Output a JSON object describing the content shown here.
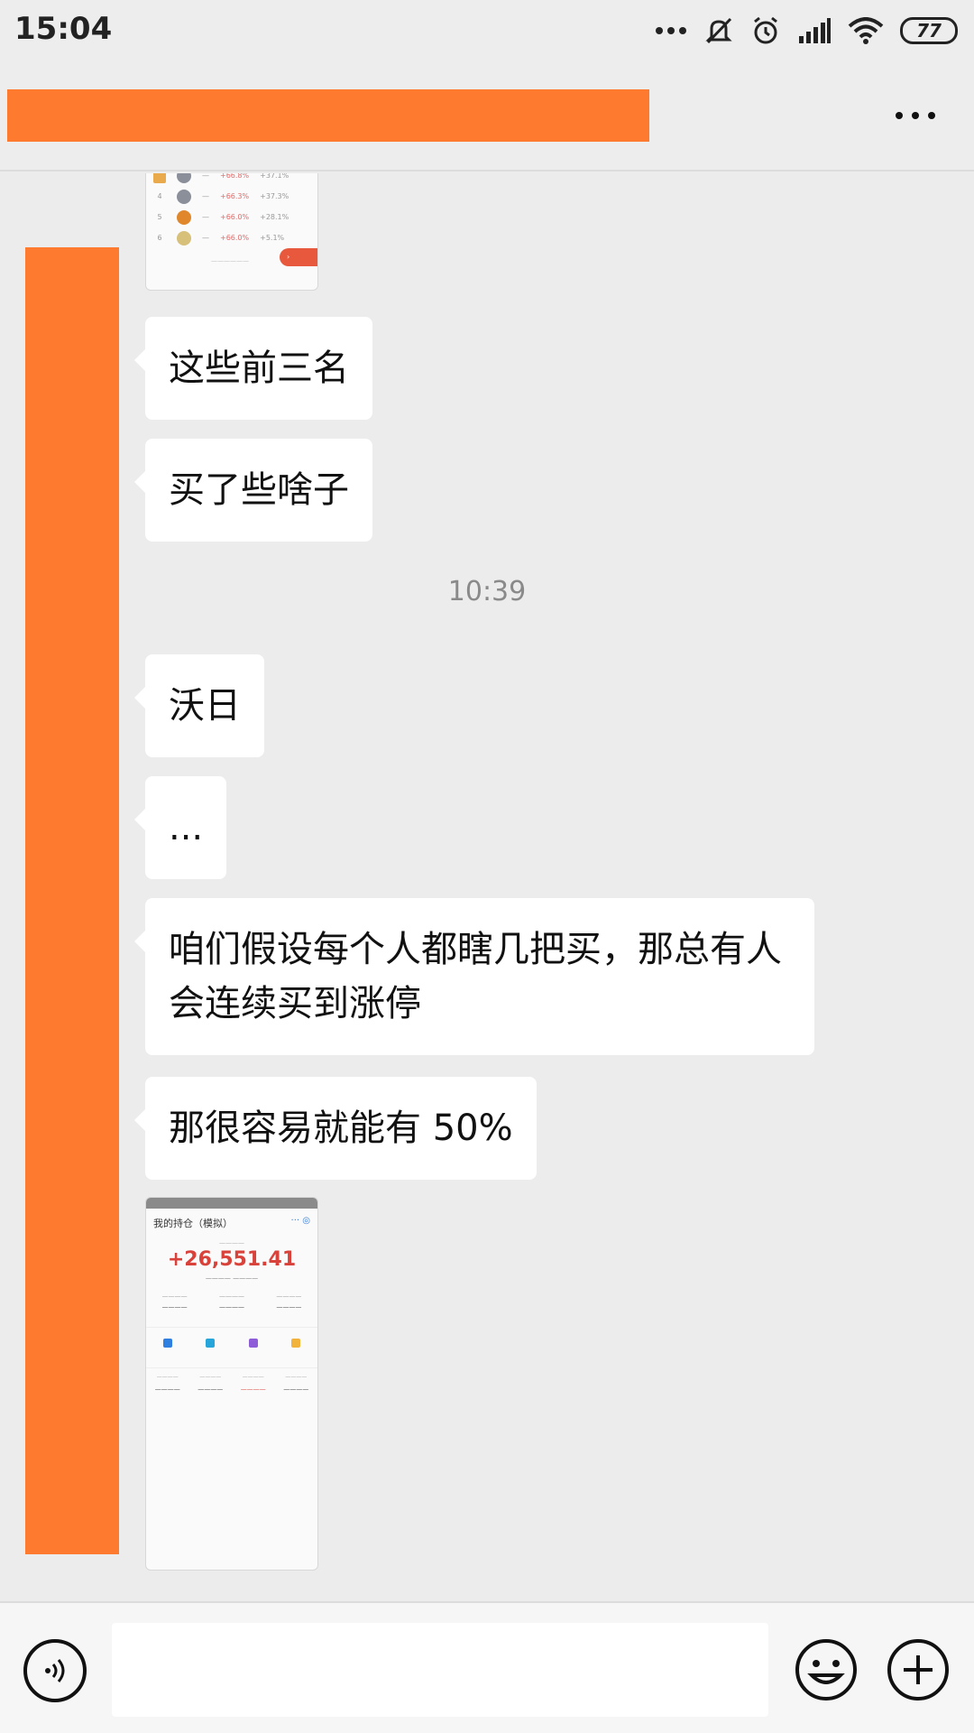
{
  "status_bar": {
    "time": "15:04",
    "battery": "77"
  },
  "chat": {
    "messages": [
      {
        "type": "image",
        "description_id": "leaderboard"
      },
      {
        "type": "text",
        "text": "这些前三名"
      },
      {
        "type": "text",
        "text": "买了些啥子"
      },
      {
        "type": "timestamp",
        "text": "10:39"
      },
      {
        "type": "text",
        "text": "沃日"
      },
      {
        "type": "text",
        "text": "..."
      },
      {
        "type": "text",
        "text": "咱们假设每个人都瞎几把买，那总有人会连续买到涨停"
      },
      {
        "type": "text",
        "text": "那很容易就能有 50%"
      },
      {
        "type": "image",
        "description_id": "portfolio"
      }
    ],
    "image2": {
      "title": "我的持仓（模拟）",
      "amount": "+26,551.41"
    }
  },
  "colors": {
    "redaction": "#fd7a2e",
    "background": "#ececec",
    "bubble": "#ffffff"
  },
  "icons": {
    "voice": "voice-icon",
    "emoji": "emoji-icon",
    "plus": "plus-icon",
    "more": "more-icon"
  }
}
